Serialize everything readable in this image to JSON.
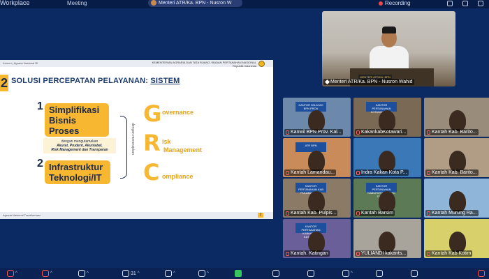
{
  "topbar": {
    "brand": "Workplace",
    "meeting": "Meeting",
    "speaker_pill": "Menteri ATR/Ka. BPN - Nusron W",
    "recording": "Recording"
  },
  "slide": {
    "header_left": "Kemen | Agraria Nasional RI",
    "ministry": "KEMENTERIAN AGRARIA DAN TATA RUANG / BADAN PERTANAHAN NASIONAL\nRepublik Indonesia",
    "number": "2",
    "title_prefix": "SOLUSI PERCEPATAN PELAYANAN: ",
    "title_emph": "SISTEM",
    "item1_num": "1",
    "item1_l1": "Simplifikasi",
    "item1_l2": "Bisnis",
    "item1_l3": "Proses",
    "sub_note_intro": "dengan mengutamakan",
    "sub_note_l1": "Akurat, Prudent, Akuntabel,",
    "sub_note_l2": "Risk Management dan Transparan",
    "item2_num": "2",
    "item2_l1": "Infrastruktur",
    "item2_l2": "Teknologi/IT",
    "vert_text": "dengan menerapkan",
    "grc_g": "G",
    "grc_r": "R",
    "grc_c": "C",
    "grc_g_word": "overnance",
    "grc_r_word_l1": "isk",
    "grc_r_word_l2": "Management",
    "grc_c_word": "ompliance",
    "footer": "Agraria Nasional Transformasi",
    "page": "2"
  },
  "speaker": {
    "nameplate": "MENTERI ATR/KA. BPN",
    "label": "Menteri ATR/Ka. BPN - Nusron Wahid"
  },
  "grid": [
    {
      "label": "Kanwil BPN Prov. Kal...",
      "sign": "KANTOR WILAYAH BPN PROV",
      "bg": "#6c88ab",
      "muted": true
    },
    {
      "label": "KakankabKotawari...",
      "sign": "KANTOR PERTANAHAN KOTAWARINGIN",
      "bg": "#7a6a55",
      "muted": true
    },
    {
      "label": "Kantah Kab. Barito...",
      "sign": "",
      "bg": "#9a8c7a",
      "muted": true
    },
    {
      "label": "Kantah Lamandau...",
      "sign": "ATR BPN",
      "bg": "#c98b5a",
      "muted": true
    },
    {
      "label": "Indra Kakan Kota P...",
      "sign": "",
      "bg": "#3a78b8",
      "muted": true
    },
    {
      "label": "Kantah Kab. Barito...",
      "sign": "",
      "bg": "#b19c86",
      "muted": true
    },
    {
      "label": "Kantah Kab. Pulpis...",
      "sign": "KANTOR PERTANAHAN KAB PULANG PISAU",
      "bg": "#8b7a66",
      "muted": true
    },
    {
      "label": "Kantah Barsim",
      "sign": "KANTOR PERTANAHAN KABUPATEN BARITO TIMUR",
      "bg": "#5c7a55",
      "muted": true
    },
    {
      "label": "Kantah Murung Ra...",
      "sign": "",
      "bg": "#8fb6d9",
      "muted": true
    },
    {
      "label": "Kantah. Katingan",
      "sign": "KANTOR PERTANAHAN KABUPATEN KATINGAN",
      "bg": "#6b5f9a",
      "muted": true
    },
    {
      "label": "YULIANDI kakants...",
      "sign": "",
      "bg": "#a8a39b",
      "muted": true
    },
    {
      "label": "Kantah Kab Kotim",
      "sign": "",
      "bg": "#d8d06a",
      "muted": true
    }
  ],
  "toolbar": {
    "participants_count": "31"
  },
  "colors": {
    "background": "#0b2a63",
    "accent_gold": "#f7b731",
    "title_blue": "#1b3a6b",
    "muted_red": "#ff5252"
  }
}
